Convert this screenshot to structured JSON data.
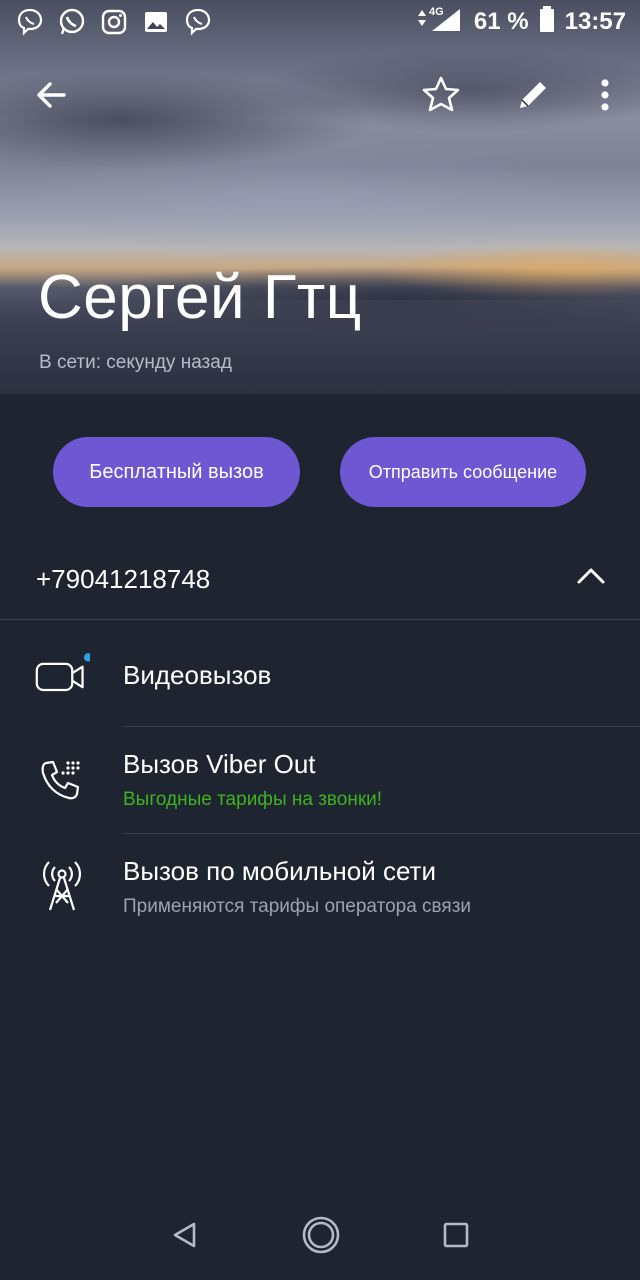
{
  "status_bar": {
    "battery_percent": "61 %",
    "time": "13:57",
    "network": "4G",
    "left_icons": [
      "viber-icon",
      "whatsapp-icon",
      "instagram-icon",
      "gallery-icon",
      "viber-icon"
    ]
  },
  "header": {
    "contact_name": "Сергей Гтц",
    "online_status": "В сети: секунду назад"
  },
  "actions": {
    "free_call_label": "Бесплатный вызов",
    "send_message_label": "Отправить сообщение"
  },
  "phone": {
    "number": "+79041218748"
  },
  "options": [
    {
      "title": "Видеовызов",
      "subtitle": "",
      "icon": "video-camera-icon"
    },
    {
      "title": "Вызов Viber Out",
      "subtitle": "Выгодные тарифы на звонки!",
      "icon": "phone-out-icon"
    },
    {
      "title": "Вызов по мобильной сети",
      "subtitle": "Применяются тарифы оператора связи",
      "icon": "cell-tower-icon"
    }
  ],
  "colors": {
    "accent": "#6f57d4",
    "background": "#1e2530",
    "promo_green": "#3fb21f",
    "subtitle_gray": "#9aa3b0",
    "notification_dot": "#2ba3e6"
  }
}
